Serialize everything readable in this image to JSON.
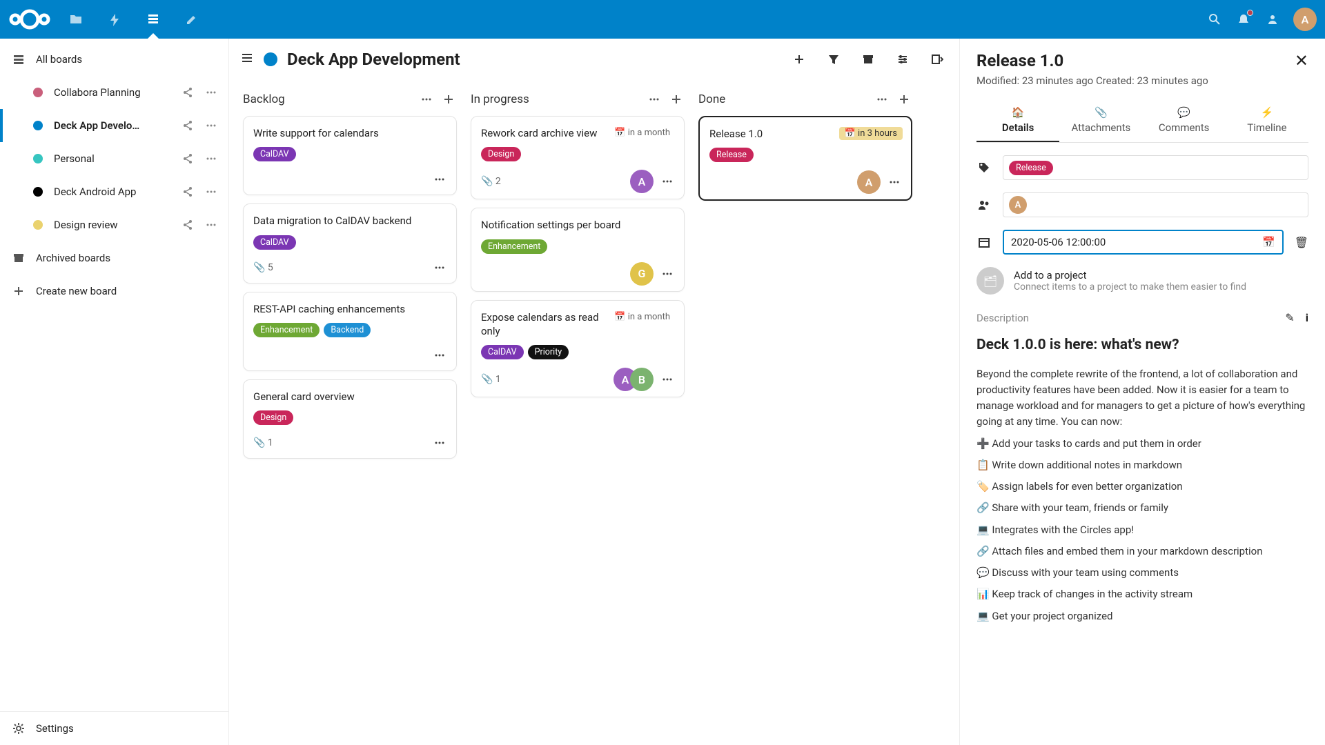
{
  "topbar": {
    "user_initial": "A"
  },
  "sidebar": {
    "all_boards": "All boards",
    "boards": [
      {
        "name": "Collabora Planning",
        "color": "#c95f7b",
        "selected": false
      },
      {
        "name": "Deck App Develo…",
        "color": "#0082c9",
        "selected": true
      },
      {
        "name": "Personal",
        "color": "#36c5c0",
        "selected": false
      },
      {
        "name": "Deck Android App",
        "color": "#000000",
        "selected": false
      },
      {
        "name": "Design review",
        "color": "#ead26e",
        "selected": false
      }
    ],
    "archived": "Archived boards",
    "create": "Create new board",
    "settings": "Settings"
  },
  "board": {
    "title": "Deck App Development",
    "stacks": [
      {
        "title": "Backlog",
        "cards": [
          {
            "title": "Write support for calendars",
            "labels": [
              {
                "t": "CalDAV",
                "c": "#7b36b3"
              }
            ],
            "attach": null,
            "avatars": [],
            "due": null
          },
          {
            "title": "Data migration to CalDAV backend",
            "labels": [
              {
                "t": "CalDAV",
                "c": "#7b36b3"
              }
            ],
            "attach": "5",
            "avatars": [],
            "due": null
          },
          {
            "title": "REST-API caching enhancements",
            "labels": [
              {
                "t": "Enhancement",
                "c": "#6ea834"
              },
              {
                "t": "Backend",
                "c": "#1e90d4"
              }
            ],
            "attach": null,
            "avatars": [],
            "due": null
          },
          {
            "title": "General card overview",
            "labels": [
              {
                "t": "Design",
                "c": "#c9265a"
              }
            ],
            "attach": "1",
            "avatars": [],
            "due": null
          }
        ]
      },
      {
        "title": "In progress",
        "cards": [
          {
            "title": "Rework card archive view",
            "labels": [
              {
                "t": "Design",
                "c": "#c9265a"
              }
            ],
            "attach": "2",
            "avatars": [
              {
                "i": "A",
                "c": "#9b5fc0"
              }
            ],
            "due": {
              "t": "in a month",
              "warn": false
            }
          },
          {
            "title": "Notification settings per board",
            "labels": [
              {
                "t": "Enhancement",
                "c": "#6ea834"
              }
            ],
            "attach": null,
            "avatars": [
              {
                "i": "G",
                "c": "#e0c34a"
              }
            ],
            "due": null
          },
          {
            "title": "Expose calendars as read only",
            "labels": [
              {
                "t": "CalDAV",
                "c": "#7b36b3"
              },
              {
                "t": "Priority",
                "c": "#111"
              }
            ],
            "attach": "1",
            "avatars": [
              {
                "i": "A",
                "c": "#9b5fc0"
              },
              {
                "i": "B",
                "c": "#7bb36f"
              }
            ],
            "due": {
              "t": "in a month",
              "warn": false
            }
          }
        ]
      },
      {
        "title": "Done",
        "cards": [
          {
            "title": "Release 1.0",
            "labels": [
              {
                "t": "Release",
                "c": "#c9265a"
              }
            ],
            "attach": null,
            "avatars": [
              {
                "i": "A",
                "c": "#d09e6d"
              }
            ],
            "due": {
              "t": "in 3 hours",
              "warn": true
            },
            "selected": true
          }
        ]
      }
    ]
  },
  "details": {
    "title": "Release 1.0",
    "subtitle": "Modified: 23 minutes ago Created: 23 minutes ago",
    "tabs": {
      "details": "Details",
      "attachments": "Attachments",
      "comments": "Comments",
      "timeline": "Timeline"
    },
    "tag": {
      "t": "Release",
      "c": "#c9265a"
    },
    "assignee": {
      "i": "A",
      "c": "#d09e6d"
    },
    "date": "2020-05-06 12:00:00",
    "project_title": "Add to a project",
    "project_sub": "Connect items to a project to make them easier to find",
    "desc_label": "Description",
    "desc_heading": "Deck 1.0.0 is here: what's new?",
    "desc_intro": "Beyond the complete rewrite of the frontend, a lot of collaboration and productivity features have been added. Now it is easier for a team to manage workload and for managers to get a picture of how's everything going at any time. You can now:",
    "desc_items": [
      "➕ Add your tasks to cards and put them in order",
      "📋 Write down additional notes in markdown",
      "🏷️ Assign labels for even better organization",
      "🔗 Share with your team, friends or family",
      "💻 Integrates with the Circles app!",
      "🔗 Attach files and embed them in your markdown description",
      "💬 Discuss with your team using comments",
      "📊 Keep track of changes in the activity stream",
      "💻 Get your project organized"
    ]
  }
}
